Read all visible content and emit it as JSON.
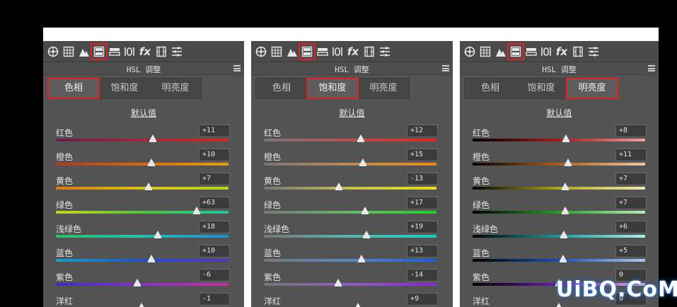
{
  "panel_title": "HSL 调整",
  "default_label": "默认值",
  "tabs": [
    "色相",
    "饱和度",
    "明亮度"
  ],
  "toolbar_icons": [
    "basic-icon",
    "tone-curve-icon",
    "detail-icon",
    "hsl-icon",
    "split-toning-icon",
    "lens-icon",
    "fx-icon",
    "camera-calibration-icon",
    "presets-icon"
  ],
  "fx_label": "fx",
  "watermark": "UiBQ.CoM",
  "highlight_color": "#e2202a",
  "panels": [
    {
      "selected_tab": 0,
      "rows": [
        {
          "label": "红色",
          "value": "+11",
          "pos": 0.56
        },
        {
          "label": "橙色",
          "value": "+10",
          "pos": 0.555
        },
        {
          "label": "黄色",
          "value": "+7",
          "pos": 0.535
        },
        {
          "label": "绿色",
          "value": "+63",
          "pos": 0.815
        },
        {
          "label": "浅绿色",
          "value": "+18",
          "pos": 0.59
        },
        {
          "label": "蓝色",
          "value": "+10",
          "pos": 0.555
        },
        {
          "label": "紫色",
          "value": "-6",
          "pos": 0.47
        },
        {
          "label": "洋红",
          "value": "-1",
          "pos": 0.495
        }
      ]
    },
    {
      "selected_tab": 1,
      "rows": [
        {
          "label": "红色",
          "value": "+12",
          "pos": 0.56
        },
        {
          "label": "橙色",
          "value": "+15",
          "pos": 0.575
        },
        {
          "label": "黄色",
          "value": "-13",
          "pos": 0.435
        },
        {
          "label": "绿色",
          "value": "+17",
          "pos": 0.585
        },
        {
          "label": "浅绿色",
          "value": "+19",
          "pos": 0.595
        },
        {
          "label": "蓝色",
          "value": "+13",
          "pos": 0.565
        },
        {
          "label": "紫色",
          "value": "-14",
          "pos": 0.43
        },
        {
          "label": "洋红",
          "value": "+9",
          "pos": 0.545
        }
      ]
    },
    {
      "selected_tab": 2,
      "rows": [
        {
          "label": "红色",
          "value": "+8",
          "pos": 0.54
        },
        {
          "label": "橙色",
          "value": "+11",
          "pos": 0.555
        },
        {
          "label": "黄色",
          "value": "+7",
          "pos": 0.535
        },
        {
          "label": "绿色",
          "value": "+7",
          "pos": 0.535
        },
        {
          "label": "浅绿色",
          "value": "+6",
          "pos": 0.53
        },
        {
          "label": "蓝色",
          "value": "+5",
          "pos": 0.525
        },
        {
          "label": "紫色",
          "value": "0",
          "pos": 0.5
        },
        {
          "label": "洋红",
          "value": "0",
          "pos": 0.5
        }
      ]
    }
  ]
}
